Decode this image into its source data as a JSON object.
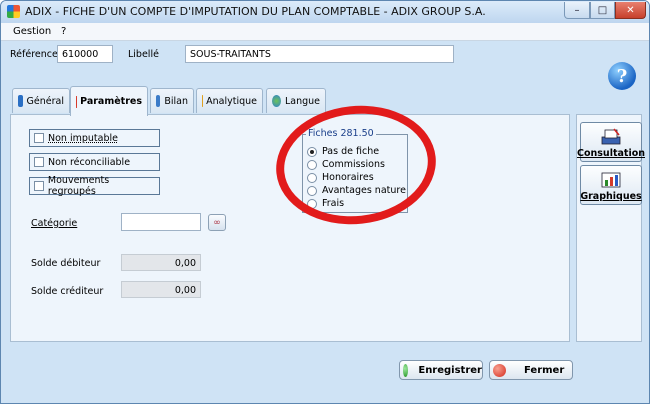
{
  "window": {
    "title": "ADIX - FICHE D'UN COMPTE D'IMPUTATION DU PLAN COMPTABLE - ADIX GROUP S.A.",
    "minimize_glyph": "–",
    "maximize_glyph": "□",
    "close_glyph": "✕"
  },
  "menu": {
    "gestion": "Gestion",
    "help": "?"
  },
  "header": {
    "reference_label": "Référence",
    "reference_value": "610000",
    "libelle_label": "Libellé",
    "libelle_value": "SOUS-TRAITANTS",
    "help_glyph": "?"
  },
  "tabs": [
    {
      "label": "Général"
    },
    {
      "label": "Paramètres"
    },
    {
      "label": "Bilan"
    },
    {
      "label": "Analytique"
    },
    {
      "label": "Langue"
    }
  ],
  "parametres": {
    "checkboxes": [
      {
        "label": "Non imputable",
        "checked": false
      },
      {
        "label": "Non réconciliable",
        "checked": false
      },
      {
        "label": "Mouvements regroupés",
        "checked": false
      }
    ],
    "categorie_label": "Catégorie",
    "categorie_value": "",
    "solde_debiteur_label": "Solde débiteur",
    "solde_debiteur_value": "0,00",
    "solde_crediteur_label": "Solde créditeur",
    "solde_crediteur_value": "0,00",
    "fiches": {
      "title": "Fiches 281.50",
      "options": [
        "Pas de fiche",
        "Commissions",
        "Honoraires",
        "Avantages nature",
        "Frais"
      ],
      "selected": "Pas de fiche"
    }
  },
  "side_buttons": {
    "consultation": "Consultation",
    "graphiques": "Graphiques"
  },
  "footer": {
    "save": "Enregistrer",
    "close": "Fermer"
  },
  "colors": {
    "highlight_ellipse": "#e21b1b",
    "save_dot": "#2a9a2a",
    "close_dot": "#d42a1c"
  }
}
